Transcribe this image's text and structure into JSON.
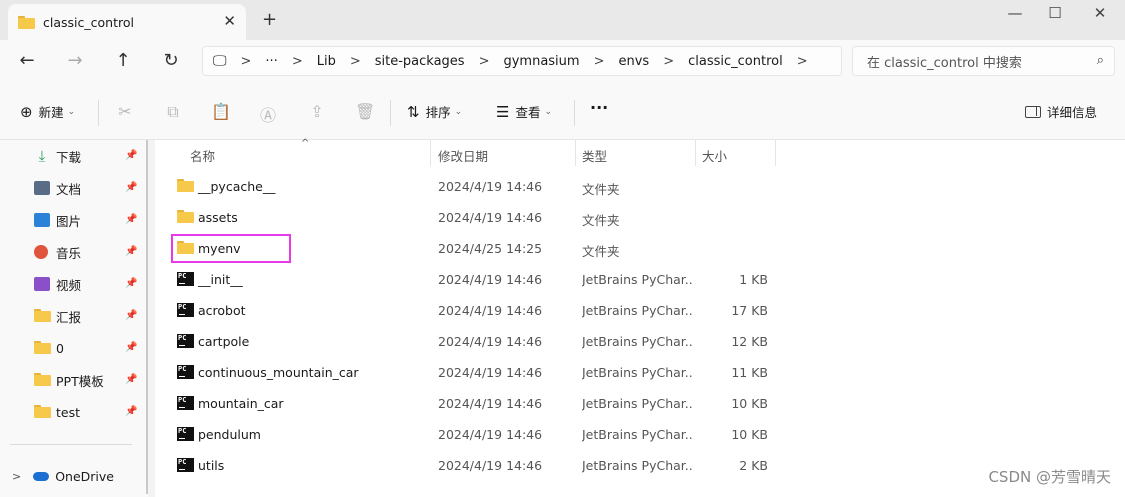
{
  "window": {
    "tab_title": "classic_control",
    "tab_close_glyph": "✕",
    "new_tab_glyph": "+",
    "minimize_glyph": "—",
    "maximize_glyph": "☐",
    "close_glyph": "✕"
  },
  "nav": {
    "back_glyph": "←",
    "forward_glyph": "→",
    "up_glyph": "↑",
    "refresh_glyph": "↻"
  },
  "address": {
    "monitor_glyph": "🖵",
    "ellipsis": "···",
    "crumbs": [
      "Lib",
      "site-packages",
      "gymnasium",
      "envs",
      "classic_control"
    ],
    "sep_glyph": ">"
  },
  "search": {
    "placeholder": "在 classic_control 中搜索",
    "icon_glyph": "⌕"
  },
  "commandbar": {
    "new_icon": "⊕",
    "new_label": "新建",
    "sort_icon": "⇅",
    "sort_label": "排序",
    "view_icon": "☰",
    "view_label": "查看",
    "more_label": "···",
    "details_label": "详细信息",
    "caret": "⌄",
    "cut_icon": "✂",
    "copy_icon": "⧉",
    "paste_icon": "📋",
    "rename_icon": "Ⓐ",
    "share_icon": "⇪",
    "delete_icon": "🗑"
  },
  "sidebar": {
    "items": [
      {
        "label": "下载",
        "icon": "download-icon",
        "color": "#2e9e5b"
      },
      {
        "label": "文档",
        "icon": "document-icon",
        "color": "#5a6b86"
      },
      {
        "label": "图片",
        "icon": "pictures-icon",
        "color": "#2a83d6"
      },
      {
        "label": "音乐",
        "icon": "music-icon",
        "color": "#e0533c"
      },
      {
        "label": "视频",
        "icon": "video-icon",
        "color": "#8a4fc9"
      },
      {
        "label": "汇报",
        "icon": "folder-icon",
        "color": "#f6c94a"
      },
      {
        "label": "0",
        "icon": "folder-icon",
        "color": "#f6c94a"
      },
      {
        "label": "PPT模板",
        "icon": "folder-icon",
        "color": "#f6c94a"
      },
      {
        "label": "test",
        "icon": "folder-icon",
        "color": "#f6c94a"
      }
    ],
    "pin_glyph": "📌",
    "onedrive": {
      "expander": ">",
      "label": "OneDrive"
    }
  },
  "columns": {
    "name": "名称",
    "date": "修改日期",
    "type": "类型",
    "size": "大小",
    "sort_glyph": "^"
  },
  "files": [
    {
      "name": "__pycache__",
      "date": "2024/4/19 14:46",
      "type": "文件夹",
      "size": "",
      "icon": "folder-icon"
    },
    {
      "name": "assets",
      "date": "2024/4/19 14:46",
      "type": "文件夹",
      "size": "",
      "icon": "folder-icon"
    },
    {
      "name": "myenv",
      "date": "2024/4/25 14:25",
      "type": "文件夹",
      "size": "",
      "icon": "folder-icon"
    },
    {
      "name": "__init__",
      "date": "2024/4/19 14:46",
      "type": "JetBrains PyChar...",
      "size": "1 KB",
      "icon": "pycharm-file-icon"
    },
    {
      "name": "acrobot",
      "date": "2024/4/19 14:46",
      "type": "JetBrains PyChar...",
      "size": "17 KB",
      "icon": "pycharm-file-icon"
    },
    {
      "name": "cartpole",
      "date": "2024/4/19 14:46",
      "type": "JetBrains PyChar...",
      "size": "12 KB",
      "icon": "pycharm-file-icon"
    },
    {
      "name": "continuous_mountain_car",
      "date": "2024/4/19 14:46",
      "type": "JetBrains PyChar...",
      "size": "11 KB",
      "icon": "pycharm-file-icon"
    },
    {
      "name": "mountain_car",
      "date": "2024/4/19 14:46",
      "type": "JetBrains PyChar...",
      "size": "10 KB",
      "icon": "pycharm-file-icon"
    },
    {
      "name": "pendulum",
      "date": "2024/4/19 14:46",
      "type": "JetBrains PyChar...",
      "size": "10 KB",
      "icon": "pycharm-file-icon"
    },
    {
      "name": "utils",
      "date": "2024/4/19 14:46",
      "type": "JetBrains PyChar...",
      "size": "2 KB",
      "icon": "pycharm-file-icon"
    }
  ],
  "pc_icon_text": "PC",
  "highlight_color": "#e83ae8",
  "watermark": "CSDN @芳雪晴天"
}
